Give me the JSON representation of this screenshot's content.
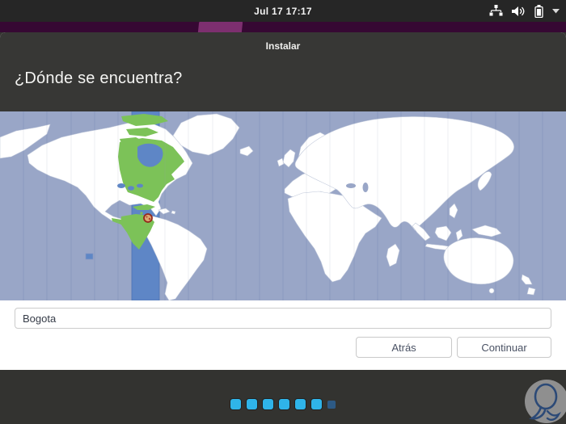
{
  "top_bar": {
    "clock": "Jul 17 17:17",
    "icons": [
      "network-wired-icon",
      "volume-icon",
      "battery-icon",
      "caret-down-icon"
    ]
  },
  "window": {
    "title": "Instalar",
    "heading": "¿Dónde se encuentra?"
  },
  "map": {
    "type": "timezone-world-map",
    "selected_city": "Bogota",
    "colors": {
      "ocean": "#99a6c7",
      "selected_timezone_band": "#5e86c6",
      "selected_region_green": "#7cc258",
      "land": "#ffffff",
      "pin_fill": "#dba571",
      "pin_border": "#94271c"
    }
  },
  "form": {
    "location_input": {
      "value": "Bogota"
    }
  },
  "actions": {
    "back_label": "Atrás",
    "continue_label": "Continuar"
  },
  "progress": {
    "steps_total": 7,
    "steps_active": 6,
    "active_color": "#2fb4e9",
    "inactive_color": "#2d5a85"
  }
}
